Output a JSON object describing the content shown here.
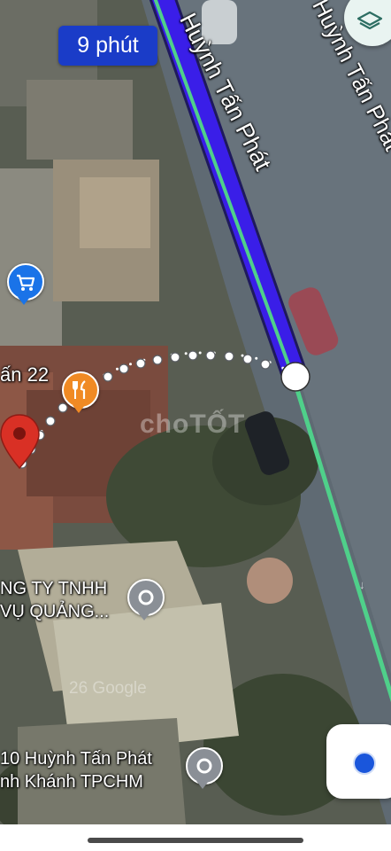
{
  "eta_label": "9 phút",
  "streets": {
    "main": "Huỳnh Tấn Phát",
    "side": "Huỳnh Tấn Phát"
  },
  "pois": {
    "restaurant_label": "ấn 22",
    "company_label_line1": "NG TY TNHH",
    "company_label_line2": "VỤ QUẢNG...",
    "address_label_line1": "10 Huỳnh Tấn Phát",
    "address_label_line2": "nh Khánh TPCHM"
  },
  "watermarks": {
    "chotot": "choTỐT",
    "google": "26 Google"
  },
  "icons": {
    "layers": "layers-icon",
    "shopping": "shopping-cart-icon",
    "restaurant": "fork-knife-icon",
    "destination": "red-pin-icon",
    "place": "gray-place-pin-icon",
    "my_location": "my-location-icon"
  },
  "colors": {
    "route_blue": "#3a1ee8",
    "route_green": "#4fd08a",
    "eta_bg": "#1a3cc8",
    "destination_pin": "#d93025",
    "restaurant_pin": "#f08a24",
    "shopping_pin": "#1a73e8",
    "place_pin": "#8a8f96"
  }
}
